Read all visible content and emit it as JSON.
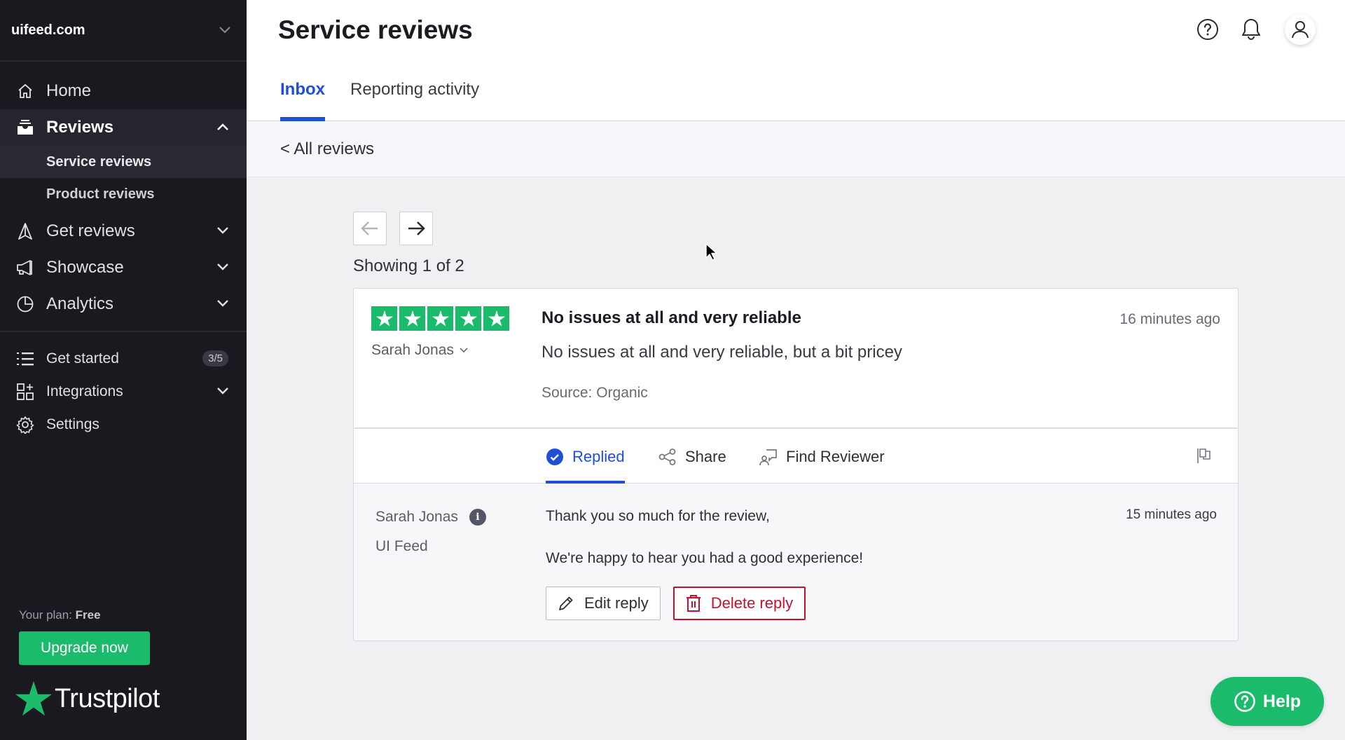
{
  "sidebar": {
    "domain": "uifeed.com",
    "nav": [
      {
        "label": "Home",
        "icon": "home-icon"
      },
      {
        "label": "Reviews",
        "icon": "inbox-icon",
        "expanded": true
      },
      {
        "label": "Get reviews",
        "icon": "paper-plane-icon"
      },
      {
        "label": "Showcase",
        "icon": "megaphone-icon"
      },
      {
        "label": "Analytics",
        "icon": "pie-chart-icon"
      }
    ],
    "sub_items": [
      {
        "label": "Service reviews",
        "active": true
      },
      {
        "label": "Product reviews",
        "active": false
      }
    ],
    "bottom_nav": [
      {
        "label": "Get started",
        "icon": "list-icon",
        "badge": "3/5"
      },
      {
        "label": "Integrations",
        "icon": "integrations-icon"
      },
      {
        "label": "Settings",
        "icon": "gear-icon"
      }
    ],
    "plan_label": "Your plan:",
    "plan_value": "Free",
    "upgrade_label": "Upgrade now",
    "logo_text": "Trustpilot"
  },
  "header": {
    "title": "Service reviews",
    "tabs": [
      {
        "label": "Inbox",
        "active": true
      },
      {
        "label": "Reporting activity",
        "active": false
      }
    ]
  },
  "subbar": {
    "back_label": "< All reviews"
  },
  "pager": {
    "showing": "Showing 1 of 2",
    "current": 1,
    "total": 2
  },
  "review": {
    "rating": 5,
    "rating_max": 5,
    "reviewer": "Sarah Jonas",
    "title": "No issues at all and very reliable",
    "time": "16 minutes ago",
    "body": "No issues at all and very reliable, but a bit pricey",
    "source": "Source: Organic",
    "actions": {
      "replied": "Replied",
      "share": "Share",
      "find_reviewer": "Find Reviewer"
    }
  },
  "reply": {
    "author": "Sarah Jonas",
    "company": "UI Feed",
    "time": "15 minutes ago",
    "line1": "Thank you so much for the review,",
    "line2": "We're happy to hear you had a good experience!",
    "edit_label": "Edit reply",
    "delete_label": "Delete reply"
  },
  "help": {
    "label": "Help"
  },
  "colors": {
    "brand_green": "#1abc6b",
    "accent_blue": "#1f4fd6",
    "danger_red": "#c8102e",
    "sidebar_bg": "#1a191f"
  }
}
